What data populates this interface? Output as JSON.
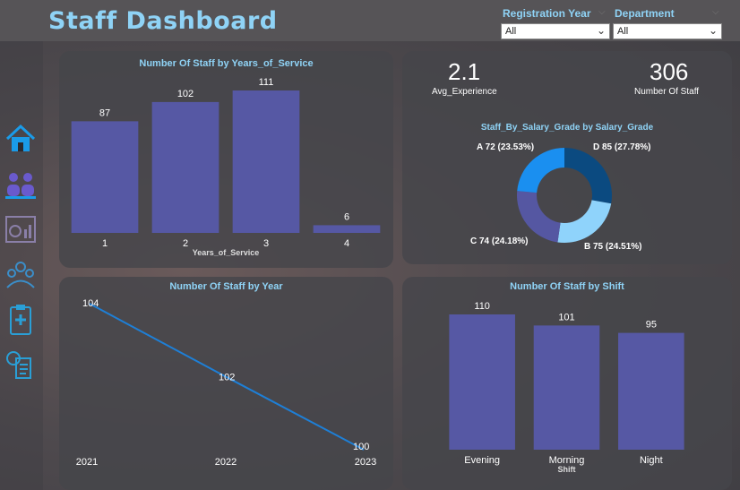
{
  "header": {
    "title": "Staff Dashboard"
  },
  "filters": {
    "registration_year": {
      "label": "Registration Year",
      "value": "All"
    },
    "department": {
      "label": "Department",
      "value": "All"
    }
  },
  "nav": {
    "icons": [
      "home-icon",
      "staff-icon",
      "analytics-icon",
      "team-icon",
      "medical-clipboard-icon",
      "document-icon"
    ]
  },
  "kpis": {
    "avg_experience": {
      "value": "2.1",
      "label": "Avg_Experience"
    },
    "number_of_staff": {
      "value": "306",
      "label": "Number Of Staff"
    }
  },
  "colors": {
    "accent": "#8fd3f6",
    "bar": "#5658a4",
    "line": "#1e7fd6",
    "donut": [
      "#0b4a80",
      "#8fd3fb",
      "#5557a2",
      "#1a8ff0"
    ]
  },
  "chart_data": [
    {
      "type": "bar",
      "title": "Number Of Staff by Years_of_Service",
      "xlabel": "Years_of_Service",
      "ylabel": "",
      "categories": [
        "1",
        "2",
        "3",
        "4"
      ],
      "values": [
        87,
        102,
        111,
        6
      ]
    },
    {
      "type": "pie",
      "title": "Staff_By_Salary_Grade by Salary_Grade",
      "slices": [
        {
          "label": "D",
          "value": 85,
          "percent": "27.78%",
          "text": "D 85 (27.78%)"
        },
        {
          "label": "B",
          "value": 75,
          "percent": "24.51%",
          "text": "B 75 (24.51%)"
        },
        {
          "label": "C",
          "value": 74,
          "percent": "24.18%",
          "text": "C 74 (24.18%)"
        },
        {
          "label": "A",
          "value": 72,
          "percent": "23.53%",
          "text": "A 72 (23.53%)"
        }
      ]
    },
    {
      "type": "line",
      "title": "Number Of Staff by Year",
      "xlabel": "",
      "ylabel": "",
      "x": [
        "2021",
        "2022",
        "2023"
      ],
      "values": [
        104,
        102,
        100
      ]
    },
    {
      "type": "bar",
      "title": "Number Of Staff by Shift",
      "xlabel": "Shift",
      "ylabel": "",
      "categories": [
        "Evening",
        "Morning",
        "Night"
      ],
      "values": [
        110,
        101,
        95
      ]
    }
  ]
}
